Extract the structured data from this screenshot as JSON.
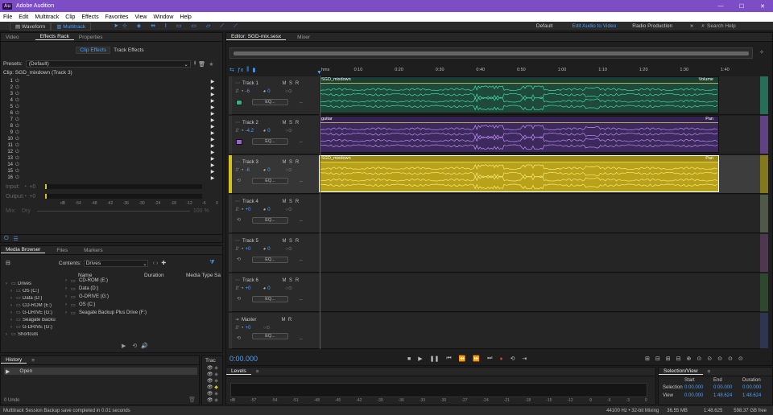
{
  "app": {
    "title": "Adobe Audition",
    "logo": "Au"
  },
  "menu": [
    "File",
    "Edit",
    "Multitrack",
    "Clip",
    "Effects",
    "Favorites",
    "View",
    "Window",
    "Help"
  ],
  "toolbar": {
    "waveform": "Waveform",
    "multitrack": "Multitrack",
    "workspaces": [
      "Default",
      "Edit Audio to Video",
      "Radio Production"
    ],
    "search_placeholder": "Search Help"
  },
  "left_tabs": [
    "Video",
    "Effects Rack",
    "Properties"
  ],
  "effects_rack": {
    "subtabs": [
      "Clip Effects",
      "Track Effects"
    ],
    "presets_label": "Presets:",
    "preset_value": "(Default)",
    "clip_label": "Clip: SGD_mixdown (Track 3)",
    "slots": [
      "1",
      "2",
      "3",
      "4",
      "5",
      "6",
      "7",
      "8",
      "9",
      "10",
      "11",
      "12",
      "13",
      "14",
      "15",
      "16"
    ],
    "input_label": "Input:",
    "input_val": "+0",
    "output_label": "Output:",
    "output_val": "+0",
    "scale": [
      "dB",
      "-54",
      "-48",
      "-42",
      "-36",
      "-30",
      "-24",
      "-18",
      "-12",
      "-6",
      "0"
    ],
    "mix_label": "Mix:",
    "dry": "Dry",
    "wet": "Wet",
    "wet_pct": "100 %"
  },
  "media": {
    "tabs": [
      "Media Browser",
      "Files",
      "Markers"
    ],
    "contents_label": "Contents:",
    "contents_value": "Drives",
    "columns": [
      "Name",
      "Duration",
      "Media Type",
      "Sa"
    ],
    "tree": [
      "Drives",
      "OS (C:)",
      "Data (D:)",
      "CD-ROM (E:)",
      "G-DRIVE (G:)",
      "Seagate Backu",
      "G-DRIVE (G:)",
      "Shortcuts"
    ],
    "list": [
      "CD-ROM (E:)",
      "Data (D:)",
      "G-DRIVE (G:)",
      "OS (C:)",
      "Seagate Backup Plus Drive (F:)"
    ]
  },
  "history": {
    "title": "History",
    "item": "Open",
    "undo": "0 Undo",
    "trac": "Trac"
  },
  "editor": {
    "tabs": [
      "Editor: SGD-mix.sesx",
      "Mixer"
    ],
    "time": "0:00.000",
    "ruler": [
      "hms",
      "0:10",
      "0:20",
      "0:30",
      "0:40",
      "0:50",
      "1:00",
      "1:10",
      "1:20",
      "1:30",
      "1:40"
    ]
  },
  "tracks": [
    {
      "name": "Track 1",
      "vol": "-6",
      "pan": "0",
      "eq": "EQ...",
      "color": "#2fb08a",
      "clip": "SGD_mixdown",
      "env": "Volume"
    },
    {
      "name": "Track 2",
      "vol": "-4.2",
      "pan": "0",
      "eq": "EQ...",
      "color": "#9b5fd6",
      "clip": "guitar",
      "env": "Pan"
    },
    {
      "name": "Track 3",
      "vol": "-6",
      "pan": "0",
      "eq": "EQ...",
      "color": "#d8c21e",
      "clip": "SGD_mixdown",
      "env": "Pan"
    },
    {
      "name": "Track 4",
      "vol": "+0",
      "pan": "0",
      "eq": "EQ..."
    },
    {
      "name": "Track 5",
      "vol": "+0",
      "pan": "0",
      "eq": "EQ..."
    },
    {
      "name": "Track 6",
      "vol": "+0",
      "pan": "0",
      "eq": "EQ..."
    },
    {
      "name": "Master",
      "vol": "+0",
      "pan": "",
      "eq": "EQ..."
    }
  ],
  "levels": {
    "title": "Levels",
    "scale": [
      "dB",
      "-57",
      "-54",
      "-51",
      "-48",
      "-45",
      "-42",
      "-39",
      "-36",
      "-33",
      "-30",
      "-27",
      "-24",
      "-21",
      "-18",
      "-15",
      "-12",
      "-9",
      "-6",
      "-3",
      "0"
    ]
  },
  "selection": {
    "title": "Selection/View",
    "cols": [
      "Start",
      "End",
      "Duration"
    ],
    "rows": [
      {
        "label": "Selection",
        "start": "0:00.000",
        "end": "0:00.000",
        "dur": "0:00.000"
      },
      {
        "label": "View",
        "start": "0:00.000",
        "end": "1:48.624",
        "dur": "1:48.624"
      }
    ]
  },
  "status": {
    "left": "Multitrack Session Backup save completed in 0.01 seconds",
    "rate": "44100 Hz • 32-bit Mixing",
    "mem": "36.55 MB",
    "dur": "1:48.625",
    "free": "598.37 GB free"
  },
  "colors": {
    "accent": "#4d9fff",
    "title": "#7c4dc4",
    "green": "#2fb08a",
    "purple": "#9b5fd6",
    "yellow": "#d8c21e"
  }
}
